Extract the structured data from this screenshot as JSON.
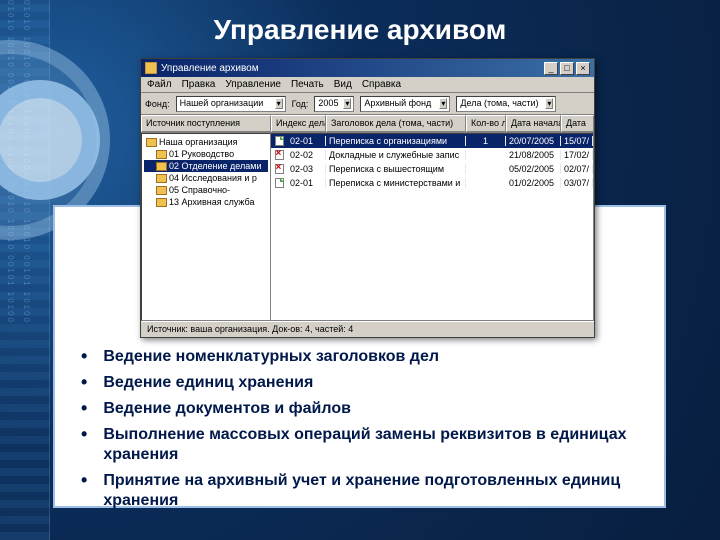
{
  "slide": {
    "title": "Управление архивом"
  },
  "window": {
    "title": "Управление архивом",
    "menu": [
      "Файл",
      "Правка",
      "Управление",
      "Печать",
      "Вид",
      "Справка"
    ],
    "toolbar": {
      "fund_label": "Фонд:",
      "fund_value": "Нашей организации",
      "year_label": "Год:",
      "year_value": "2005",
      "section_value": "Архивный фонд",
      "dela_value": "Дела (тома, части)"
    },
    "headers": {
      "left": "Источник поступления",
      "mid1": "Индекс дела",
      "mid2": "Заголовок дела (тома, части)",
      "right1": "Кол-во лист.",
      "right2": "Дата начала",
      "right3": "Дата"
    },
    "tree": [
      {
        "label": "Наша организация",
        "indent": 0
      },
      {
        "label": "01 Руководство",
        "indent": 1
      },
      {
        "label": "02 Отделение делами",
        "indent": 1,
        "sel": true
      },
      {
        "label": "04 Исследования и р",
        "indent": 1
      },
      {
        "label": "05 Справочно-",
        "indent": 1
      },
      {
        "label": "13 Архивная служба",
        "indent": 1
      }
    ],
    "list": [
      {
        "idx": "02-01",
        "title": "Переписка с организациями",
        "n": "1",
        "d1": "20/07/2005",
        "d2": "15/07/",
        "sel": true,
        "ic": "g"
      },
      {
        "idx": "02-02",
        "title": "Докладные и служебные запис",
        "n": "",
        "d1": "21/08/2005",
        "d2": "17/02/",
        "ic": "r"
      },
      {
        "idx": "02-03",
        "title": "Переписка с вышестоящим",
        "n": "",
        "d1": "05/02/2005",
        "d2": "02/07/",
        "ic": "r"
      },
      {
        "idx": "02-01",
        "title": "Переписка с министерствами и",
        "n": "",
        "d1": "01/02/2005",
        "d2": "03/07/",
        "ic": "g"
      }
    ],
    "status": "Источник: ваша организация. Док-ов: 4, частей: 4"
  },
  "bullets": [
    "Ведение номенклатурных заголовков дел",
    "Ведение единиц хранения",
    "Ведение документов и файлов",
    "Выполнение массовых операций замены реквизитов в единицах хранения",
    "Принятие на архивный учет и хранение подготовленных единиц хранения"
  ]
}
